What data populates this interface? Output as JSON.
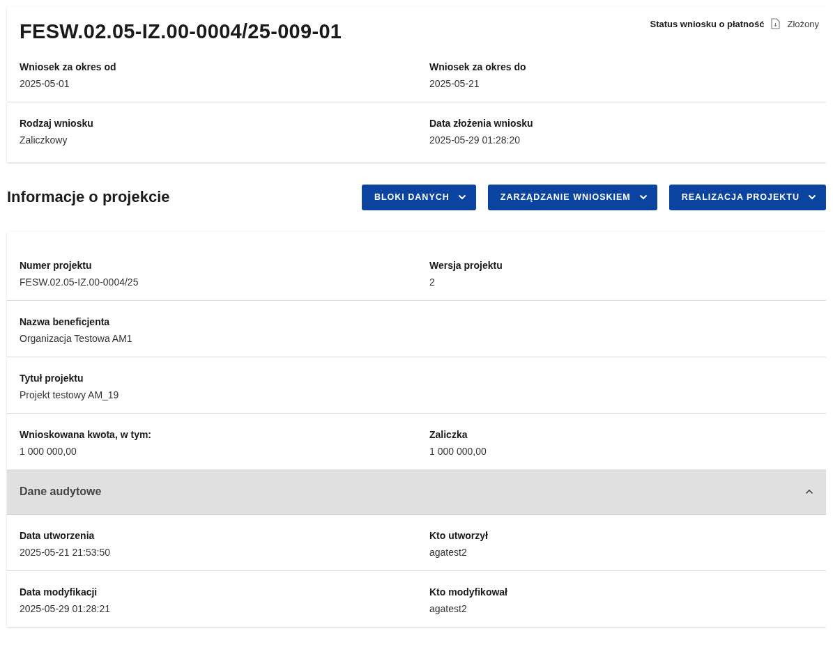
{
  "header": {
    "title": "FESW.02.05-IZ.00-0004/25-009-01",
    "status_label": "Status wniosku o płatność",
    "status_value": "Złożony",
    "rows": [
      [
        {
          "label": "Wniosek za okres od",
          "value": "2025-05-01"
        },
        {
          "label": "Wniosek za okres do",
          "value": "2025-05-21"
        }
      ],
      [
        {
          "label": "Rodzaj wniosku",
          "value": "Zaliczkowy"
        },
        {
          "label": "Data złożenia wniosku",
          "value": "2025-05-29 01:28:20"
        }
      ]
    ]
  },
  "section": {
    "title": "Informacje o projekcie",
    "buttons": [
      "BLOKI DANYCH",
      "ZARZĄDZANIE WNIOSKIEM",
      "REALIZACJA PROJEKTU"
    ]
  },
  "project": {
    "rows": [
      [
        {
          "label": "Numer projektu",
          "value": "FESW.02.05-IZ.00-0004/25"
        },
        {
          "label": "Wersja projektu",
          "value": "2"
        }
      ],
      [
        {
          "label": "Nazwa beneficjenta",
          "value": "Organizacja Testowa AM1"
        }
      ],
      [
        {
          "label": "Tytuł projektu",
          "value": "Projekt testowy AM_19"
        }
      ],
      [
        {
          "label": "Wnioskowana kwota, w tym:",
          "value": "1 000 000,00"
        },
        {
          "label": "Zaliczka",
          "value": "1 000 000,00"
        }
      ]
    ],
    "audit": {
      "title": "Dane audytowe",
      "expanded": true,
      "rows": [
        [
          {
            "label": "Data utworzenia",
            "value": "2025-05-21 21:53:50"
          },
          {
            "label": "Kto utworzył",
            "value": "agatest2"
          }
        ],
        [
          {
            "label": "Data modyfikacji",
            "value": "2025-05-29 01:28:21"
          },
          {
            "label": "Kto modyfikował",
            "value": "agatest2"
          }
        ]
      ]
    }
  }
}
